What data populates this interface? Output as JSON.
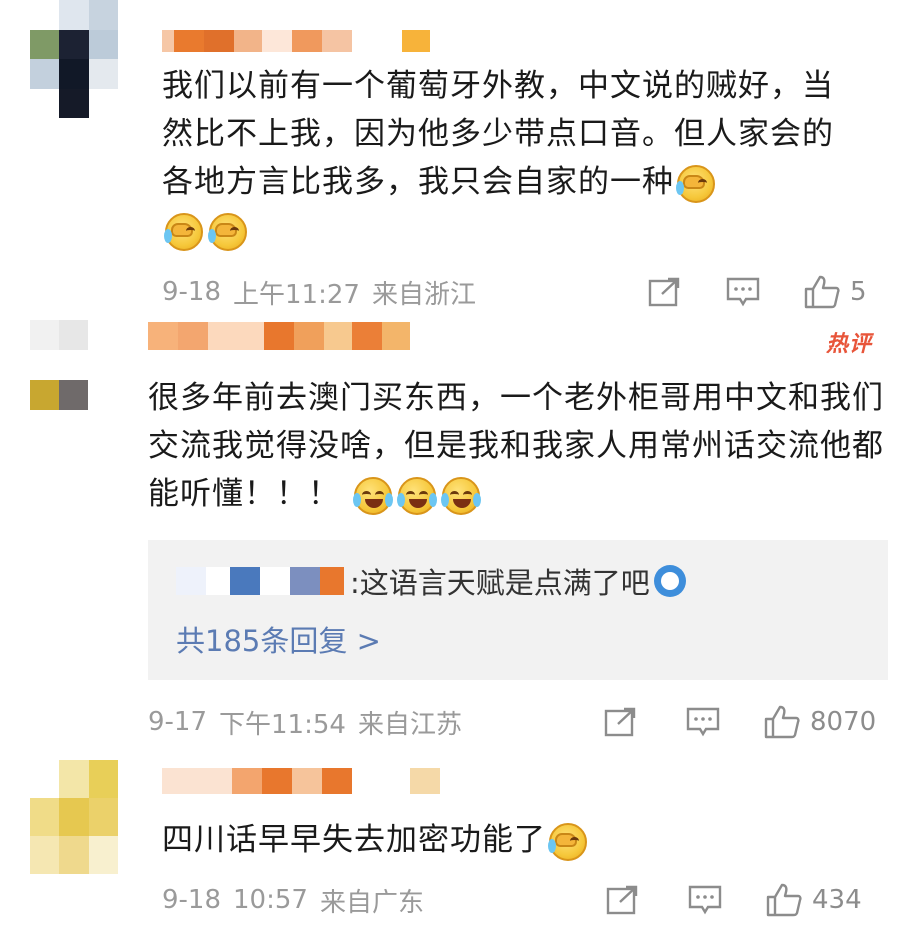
{
  "comments": [
    {
      "text": "我们以前有一个葡萄牙外教，中文说的贼好，当然比不上我，因为他多少带点口音。但人家会的各地方言比我多，我只会自家的一种",
      "date": "9-18",
      "time": "上午11:27",
      "location": "来自浙江",
      "likes": "5",
      "emoji": "facepalm",
      "avatar_colors": [
        "#ffffff",
        "#dfe6ee",
        "#c7d3df",
        "#7f9a66",
        "#1c2233",
        "#bccbd9",
        "#c3d0dd",
        "#111827",
        "#e4e9ee",
        "#ffffff",
        "#151a28",
        "#ffffff"
      ],
      "username_colors": [
        "#f6c7a6",
        "#e97a2e",
        "#e0702b",
        "#f2b489",
        "#fde7d9",
        "#f0995d",
        "#f5c4a3",
        "#ffffff",
        "#f7b33a"
      ]
    },
    {
      "badge": "热评",
      "text": "很多年前去澳门买东西，一个老外柜哥用中文和我们交流我觉得没啥，但是我和我家人用常州话交流他都能听懂！！！",
      "emoji": "laugh-cry",
      "reply": {
        "text": ":这语言天赋是点满了吧",
        "more": "共185条回复 >",
        "emoji": "doge",
        "username_colors": [
          "#eef2fb",
          "#ffffff",
          "#4a79bd",
          "#ffffff",
          "#7c8fbf",
          "#e8772d"
        ]
      },
      "date": "9-17",
      "time": "下午11:54",
      "location": "来自江苏",
      "likes": "8070",
      "avatar_colors": [
        "#f1f1f1",
        "#e7e7e7",
        "#ffffff",
        "#ffffff",
        "#c8a730",
        "#6f6a6a"
      ],
      "username_colors": [
        "#f7b27a",
        "#f3a66f",
        "#fcd9bd",
        "#e8772d",
        "#f0a05b",
        "#f7c98f",
        "#eb7f37",
        "#f3b56a"
      ]
    },
    {
      "text": "四川话早早失去加密功能了",
      "emoji": "facepalm",
      "date": "9-18",
      "time": "10:57",
      "location": "来自广东",
      "likes": "434",
      "avatar_colors": [
        "#ffffff",
        "#f3e6a8",
        "#e8cf58",
        "#f0dc88",
        "#e6c850",
        "#ebd16a",
        "#f5e7b2",
        "#efd98d",
        "#f8f0cf"
      ],
      "username_colors": [
        "#fbe3d2",
        "#f3a56e",
        "#e8772d",
        "#f6c49b",
        "#e8772d",
        "#ffffff",
        "#f5d9a8"
      ]
    }
  ],
  "icons": {
    "share": "share-icon",
    "comment": "comment-icon",
    "like": "thumbs-up-icon"
  }
}
